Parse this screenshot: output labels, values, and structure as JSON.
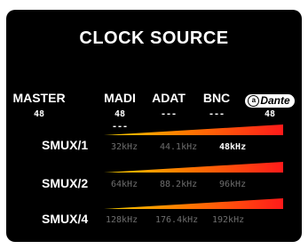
{
  "title": "CLOCK SOURCE",
  "sources": [
    {
      "label": "MASTER",
      "value": "48",
      "extra": ""
    },
    {
      "label": "MADI",
      "value": "48",
      "extra": "---"
    },
    {
      "label": "ADAT",
      "value": "---",
      "extra": ""
    },
    {
      "label": "BNC",
      "value": "---",
      "extra": ""
    },
    {
      "label": "Dante",
      "value": "48",
      "extra": ""
    }
  ],
  "smux_rows": [
    {
      "label": "SMUX/1",
      "rates": [
        "32kHz",
        "44.1kHz",
        "48kHz"
      ],
      "active_index": 2
    },
    {
      "label": "SMUX/2",
      "rates": [
        "64kHz",
        "88.2kHz",
        "96kHz"
      ],
      "active_index": -1
    },
    {
      "label": "SMUX/4",
      "rates": [
        "128kHz",
        "176.4kHz",
        "192kHz"
      ],
      "active_index": -1
    }
  ],
  "colors": {
    "background": "#000000",
    "text": "#ffffff",
    "inactive_rate": "#6e6e6e",
    "bar_start": "#f5d000",
    "bar_mid": "#ff7a00",
    "bar_end": "#ff1a1a"
  }
}
